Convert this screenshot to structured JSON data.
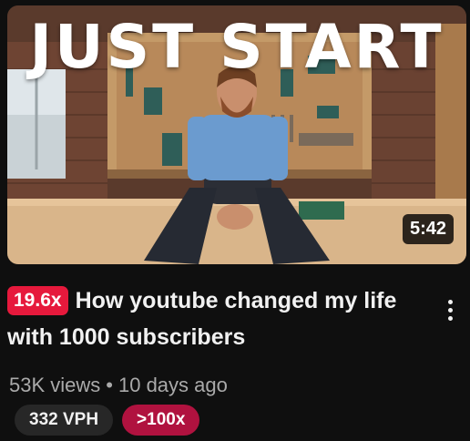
{
  "video": {
    "thumbnail_text": "JUST START",
    "duration": "5:42",
    "outlier_badge": "19.6x",
    "title": "How youtube changed my life with 1000 subscribers",
    "views": "53K views",
    "separator": "•",
    "age": "10 days ago",
    "vph_chip": "332 VPH",
    "ratio_chip": ">100x"
  },
  "colors": {
    "background": "#0f0f0f",
    "outlier_badge": "#e6193c",
    "ratio_chip": "#b0123f",
    "vph_chip": "#272727",
    "secondary_text": "#aaaaaa"
  },
  "icons": {
    "more_menu": "vertical-ellipsis-icon"
  }
}
